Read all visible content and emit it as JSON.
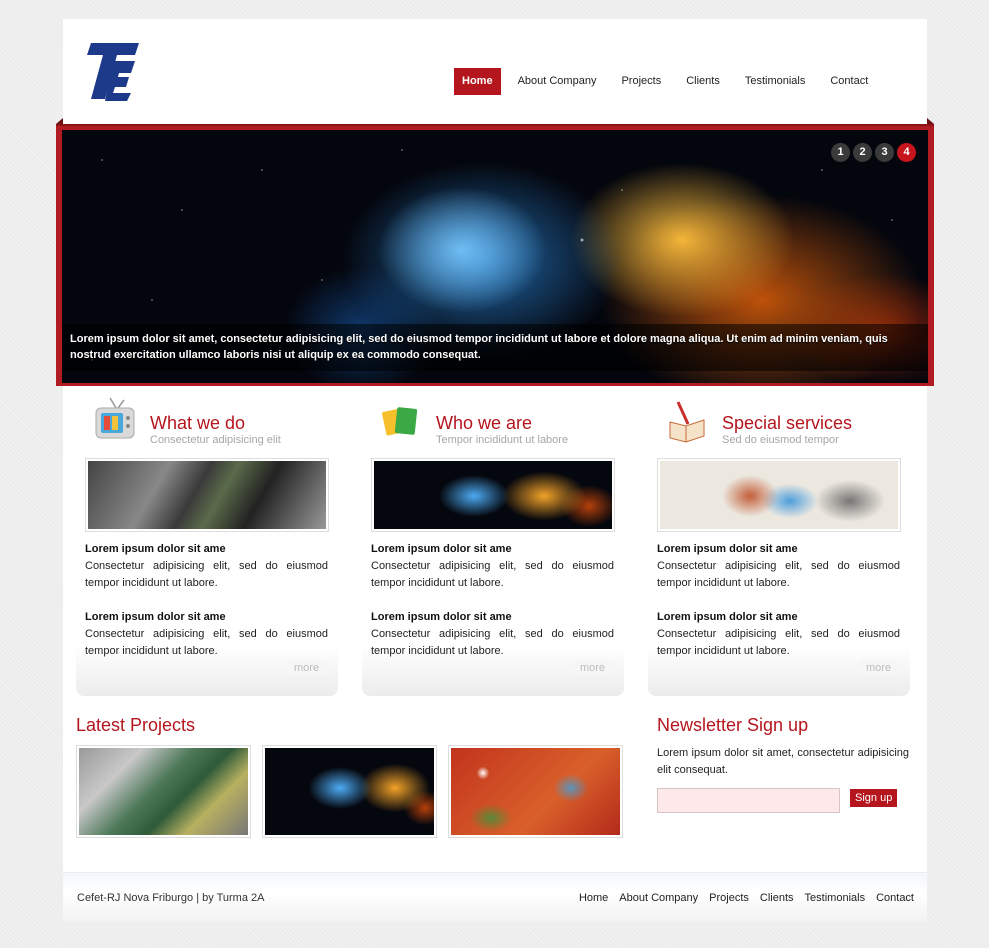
{
  "header": {
    "logo_name": "company-logo",
    "nav": [
      "Home",
      "About Company",
      "Projects",
      "Clients",
      "Testimonials",
      "Contact"
    ],
    "active_nav": "Home"
  },
  "slider": {
    "pages": [
      "1",
      "2",
      "3",
      "4"
    ],
    "active_page": "4",
    "caption": "Lorem ipsum dolor sit amet, consectetur adipisicing elit, sed do eiusmod tempor incididunt ut labore et dolore magna aliqua. Ut enim ad minim veniam, quis nostrud exercitation ullamco laboris nisi ut aliquip ex ea commodo consequat."
  },
  "columns": [
    {
      "icon": "tv-icon",
      "title": "What we do",
      "subtitle": "Consectetur adipisicing elit",
      "items": [
        {
          "heading": "Lorem ipsum dolor sit ame",
          "text": "Consectetur adipisicing elit, sed do eiusmod tempor incididunt ut labore."
        },
        {
          "heading": "Lorem ipsum dolor sit ame",
          "text": "Consectetur adipisicing elit, sed do eiusmod tempor incididunt ut labore."
        }
      ],
      "more": "more"
    },
    {
      "icon": "folders-icon",
      "title": "Who we are",
      "subtitle": "Tempor incididunt ut labore",
      "items": [
        {
          "heading": "Lorem ipsum dolor sit ame",
          "text": "Consectetur adipisicing elit, sed do eiusmod tempor incididunt ut labore."
        },
        {
          "heading": "Lorem ipsum dolor sit ame",
          "text": "Consectetur adipisicing elit, sed do eiusmod tempor incididunt ut labore."
        }
      ],
      "more": "more"
    },
    {
      "icon": "book-icon",
      "title": "Special services",
      "subtitle": "Sed do eiusmod tempor",
      "items": [
        {
          "heading": "Lorem ipsum dolor sit ame",
          "text": "Consectetur adipisicing elit, sed do eiusmod tempor incididunt ut labore."
        },
        {
          "heading": "Lorem ipsum dolor sit ame",
          "text": "Consectetur adipisicing elit, sed do eiusmod tempor incididunt ut labore."
        }
      ],
      "more": "more"
    }
  ],
  "projects": {
    "title": "Latest Projects"
  },
  "newsletter": {
    "title": "Newsletter Sign up",
    "text": "Lorem ipsum dolor sit amet, consectetur adipisicing elit consequat.",
    "email_value": "",
    "button": "Sign up"
  },
  "footer": {
    "credit": "Cefet-RJ Nova Friburgo | by Turma 2A",
    "nav": [
      "Home",
      "About Company",
      "Projects",
      "Clients",
      "Testimonials",
      "Contact"
    ]
  },
  "colors": {
    "accent": "#b5151c",
    "background": "#ececec"
  }
}
